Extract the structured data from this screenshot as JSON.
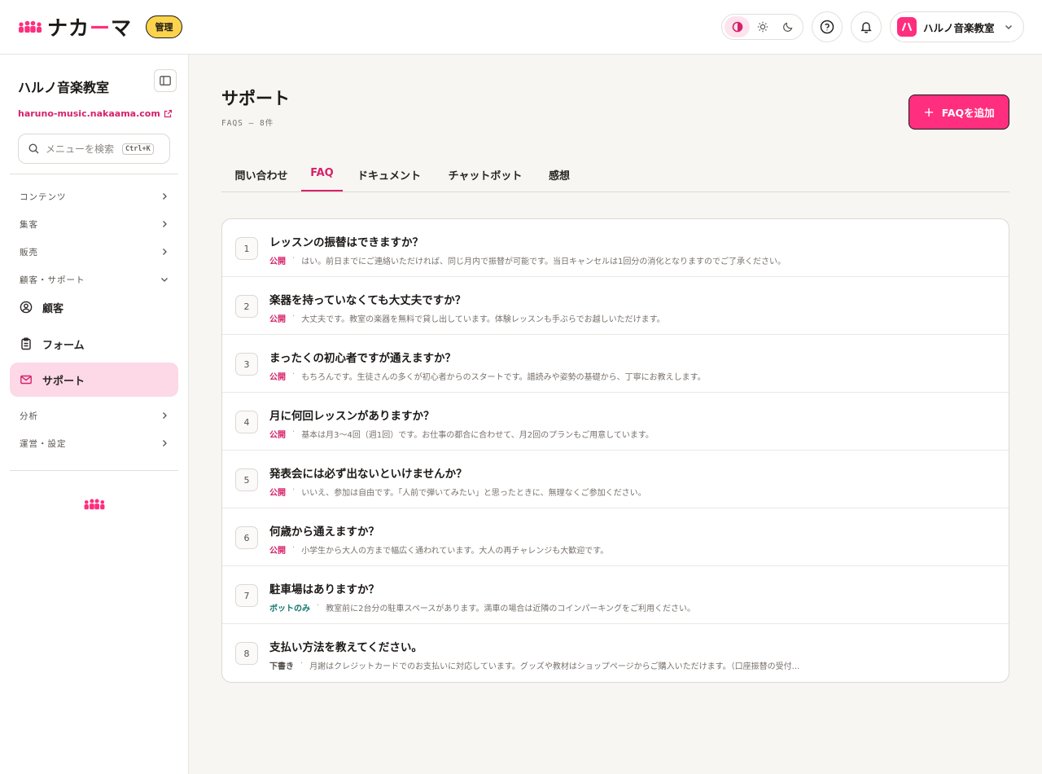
{
  "header": {
    "brand": "ナカーマ",
    "brand_pre": "ナカ",
    "brand_dash": "ー",
    "brand_post": "マ",
    "admin_badge": "管理",
    "account_initial": "ハ",
    "account_name": "ハルノ音楽教室"
  },
  "sidebar": {
    "org_name": "ハルノ音楽教室",
    "site_url": "haruno-music.nakaama.com",
    "search_placeholder": "メニューを検索",
    "search_shortcut": "Ctrl+K",
    "sections": [
      {
        "label": "コンテンツ"
      },
      {
        "label": "集客"
      },
      {
        "label": "販売"
      },
      {
        "label": "顧客・サポート"
      },
      {
        "label": "分析"
      },
      {
        "label": "運営・設定"
      }
    ],
    "items": [
      {
        "label": "顧客",
        "icon": "user-circle-icon"
      },
      {
        "label": "フォーム",
        "icon": "clipboard-icon"
      },
      {
        "label": "サポート",
        "icon": "mail-icon"
      }
    ]
  },
  "main": {
    "title": "サポート",
    "subtitle": "FAQS — 8件",
    "add_button": "FAQを追加",
    "tabs": [
      {
        "label": "問い合わせ"
      },
      {
        "label": "FAQ"
      },
      {
        "label": "ドキュメント"
      },
      {
        "label": "チャットボット"
      },
      {
        "label": "感想"
      }
    ],
    "active_tab": "FAQ",
    "faqs": [
      {
        "num": "1",
        "question": "レッスンの振替はできますか？",
        "status": "公開",
        "status_type": "public",
        "answer": "はい。前日までにご連絡いただければ、同じ月内で振替が可能です。当日キャンセルは1回分の消化となりますのでご了承ください。"
      },
      {
        "num": "2",
        "question": "楽器を持っていなくても大丈夫ですか？",
        "status": "公開",
        "status_type": "public",
        "answer": "大丈夫です。教室の楽器を無料で貸し出しています。体験レッスンも手ぶらでお越しいただけます。"
      },
      {
        "num": "3",
        "question": "まったくの初心者ですが通えますか？",
        "status": "公開",
        "status_type": "public",
        "answer": "もちろんです。生徒さんの多くが初心者からのスタートです。譜読みや姿勢の基礎から、丁寧にお教えします。"
      },
      {
        "num": "4",
        "question": "月に何回レッスンがありますか？",
        "status": "公開",
        "status_type": "public",
        "answer": "基本は月3〜4回（週1回）です。お仕事の都合に合わせて、月2回のプランもご用意しています。"
      },
      {
        "num": "5",
        "question": "発表会には必ず出ないといけませんか？",
        "status": "公開",
        "status_type": "public",
        "answer": "いいえ、参加は自由です。「人前で弾いてみたい」と思ったときに、無理なくご参加ください。"
      },
      {
        "num": "6",
        "question": "何歳から通えますか？",
        "status": "公開",
        "status_type": "public",
        "answer": "小学生から大人の方まで幅広く通われています。大人の再チャレンジも大歓迎です。"
      },
      {
        "num": "7",
        "question": "駐車場はありますか？",
        "status": "ボットのみ",
        "status_type": "bot",
        "answer": "教室前に2台分の駐車スペースがあります。満車の場合は近隣のコインパーキングをご利用ください。"
      },
      {
        "num": "8",
        "question": "支払い方法を教えてください。",
        "status": "下書き",
        "status_type": "draft",
        "answer": "月謝はクレジットカードでのお支払いに対応しています。グッズや教材はショップページからご購入いただけます。（口座振替の受付..."
      }
    ]
  },
  "colors": {
    "accent": "#ff2e7e",
    "accent_text": "#d6226a",
    "active_nav_bg": "#fdd8e6",
    "badge_yellow": "#fcd34d",
    "bot_status": "#0f766e"
  }
}
